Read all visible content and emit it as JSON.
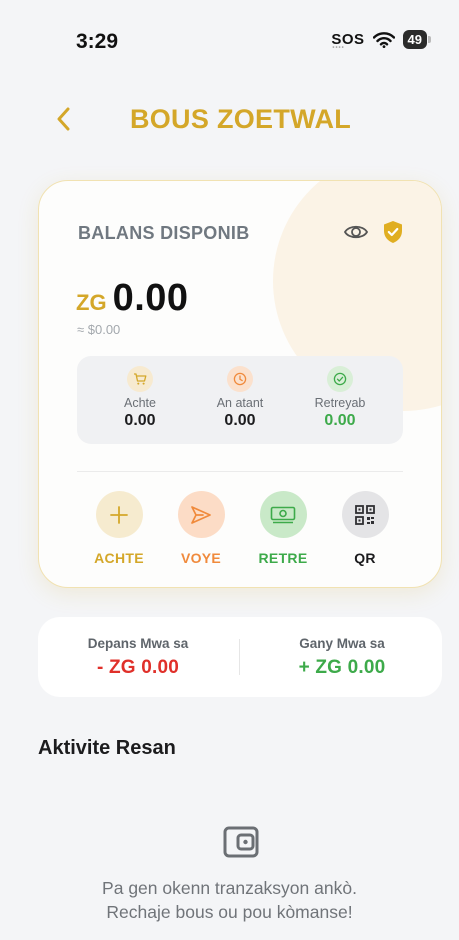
{
  "status_bar": {
    "time": "3:29",
    "sos": "SOS",
    "battery": "49"
  },
  "header": {
    "title": "BOUS ZOETWAL",
    "back_icon": "chevron-left-icon"
  },
  "wallet": {
    "label": "BALANS DISPONIB",
    "currency": "ZG",
    "amount": "0.00",
    "usd": "≈ $0.00",
    "stats": [
      {
        "icon": "cart-icon",
        "label": "Achte",
        "value": "0.00"
      },
      {
        "icon": "clock-icon",
        "label": "An atant",
        "value": "0.00"
      },
      {
        "icon": "check-circle-icon",
        "label": "Retreyab",
        "value": "0.00"
      }
    ],
    "actions": [
      {
        "icon": "plus-icon",
        "label": "ACHTE"
      },
      {
        "icon": "send-icon",
        "label": "VOYE"
      },
      {
        "icon": "cash-icon",
        "label": "RETRE"
      },
      {
        "icon": "qr-icon",
        "label": "QR"
      }
    ]
  },
  "summary": {
    "spent_label": "Depans Mwa sa",
    "spent_value": "- ZG 0.00",
    "earned_label": "Gany Mwa sa",
    "earned_value": "+ ZG 0.00"
  },
  "activity": {
    "title": "Aktivite Resan",
    "empty_line1": "Pa gen okenn tranzaksyon ankò.",
    "empty_line2": "Rechaje bous ou pou kòmanse!"
  },
  "colors": {
    "brand_gold": "#d4a729",
    "send_orange": "#f08a3c",
    "success_green": "#3daa4a",
    "danger_red": "#e0302a",
    "qr_dark": "#2f2f33"
  }
}
